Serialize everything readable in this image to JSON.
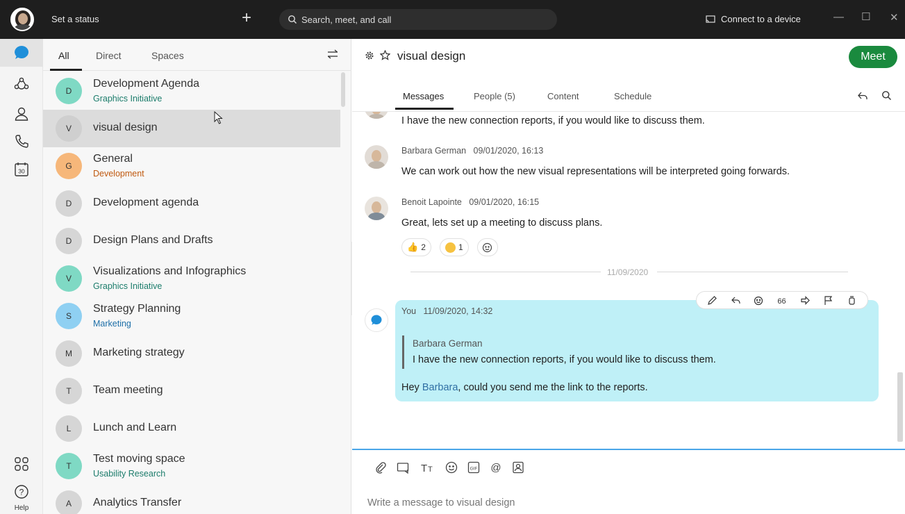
{
  "titlebar": {
    "status_label": "Set a status",
    "new_label": "+",
    "search_placeholder": "Search, meet, and call",
    "connect_label": "Connect to a device",
    "window_controls": [
      "minimize-icon",
      "maximize-icon",
      "close-icon"
    ]
  },
  "rail": {
    "items": [
      "messaging-icon",
      "teams-icon",
      "contacts-icon",
      "calls-icon",
      "calendar-icon"
    ],
    "calendar_day": "30",
    "bottom": [
      "apps-icon",
      "help-icon"
    ],
    "help_label": "Help"
  },
  "list": {
    "filters": [
      "All",
      "Direct",
      "Spaces"
    ],
    "active_filter": "All",
    "spaces": [
      {
        "initial": "D",
        "name": "Development Agenda",
        "team": "Graphics Initiative",
        "avatar_color": "#7fd9c4",
        "team_color": "#1b7c6b"
      },
      {
        "initial": "V",
        "name": "visual design",
        "team": "",
        "avatar_color": "#cfcfcf",
        "team_color": ""
      },
      {
        "initial": "G",
        "name": "General",
        "team": "Development",
        "avatar_color": "#f6b77a",
        "team_color": "#c05a10"
      },
      {
        "initial": "D",
        "name": "Development agenda",
        "team": "",
        "avatar_color": "#d6d6d6",
        "team_color": ""
      },
      {
        "initial": "D",
        "name": "Design Plans and Drafts",
        "team": "",
        "avatar_color": "#d6d6d6",
        "team_color": ""
      },
      {
        "initial": "V",
        "name": "Visualizations and Infographics",
        "team": "Graphics Initiative",
        "avatar_color": "#7fd9c4",
        "team_color": "#1b7c6b"
      },
      {
        "initial": "S",
        "name": "Strategy Planning",
        "team": "Marketing",
        "avatar_color": "#8fd0f2",
        "team_color": "#1d6fa8"
      },
      {
        "initial": "M",
        "name": "Marketing strategy",
        "team": "",
        "avatar_color": "#d6d6d6",
        "team_color": ""
      },
      {
        "initial": "T",
        "name": "Team meeting",
        "team": "",
        "avatar_color": "#d6d6d6",
        "team_color": ""
      },
      {
        "initial": "L",
        "name": "Lunch and Learn",
        "team": "",
        "avatar_color": "#d6d6d6",
        "team_color": ""
      },
      {
        "initial": "T",
        "name": "Test moving space",
        "team": "Usability Research",
        "avatar_color": "#7fd9c4",
        "team_color": "#1b7c6b"
      },
      {
        "initial": "A",
        "name": "Analytics Transfer",
        "team": "",
        "avatar_color": "#d6d6d6",
        "team_color": ""
      }
    ]
  },
  "conversation": {
    "title": "visual design",
    "meet_label": "Meet",
    "tabs": [
      "Messages",
      "People (5)",
      "Content",
      "Schedule"
    ],
    "active_tab": "Messages",
    "messages": [
      {
        "author": "",
        "timestamp": "",
        "text": "I have the new connection reports, if you would like to discuss them."
      },
      {
        "author": "Barbara German",
        "timestamp": "09/01/2020, 16:13",
        "text": "We can work out how the new visual representations will be interpreted going forwards."
      },
      {
        "author": "Benoit Lapointe",
        "timestamp": "09/01/2020, 16:15",
        "text": "Great, lets set up a meeting to discuss plans."
      }
    ],
    "reactions": [
      {
        "emoji": "thumbs-up-icon",
        "count": "2"
      },
      {
        "emoji": "laughing-icon",
        "count": "1"
      }
    ],
    "date_separator": "11/09/2020",
    "own_message": {
      "author": "You",
      "timestamp": "11/09/2020, 14:32",
      "quote_author": "Barbara German",
      "quote_text": "I have the new connection reports, if you would like to discuss them.",
      "text_before": "Hey ",
      "mention": "Barbara",
      "text_after": ", could you send me the link to the reports."
    },
    "message_actions": [
      "edit-icon",
      "reply-icon",
      "react-icon",
      "quote-icon",
      "forward-icon",
      "flag-icon",
      "delete-icon"
    ],
    "composer_tools": [
      "attach-icon",
      "screenshot-icon",
      "format-icon",
      "emoji-icon",
      "gif-icon",
      "mention-icon",
      "contact-card-icon"
    ],
    "composer_placeholder": "Write a message to visual design"
  }
}
